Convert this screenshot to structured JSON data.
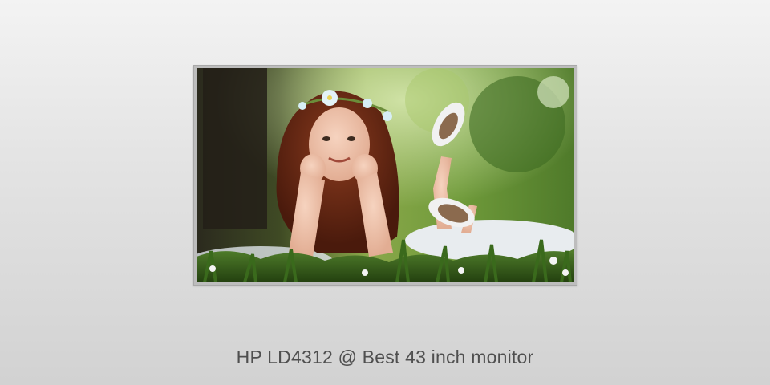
{
  "caption": "HP LD4312 @ Best 43 inch monitor",
  "image": {
    "subject": "girl-lying-in-grass-with-flower-crown"
  },
  "colors": {
    "background_top": "#f3f3f3",
    "background_bottom": "#d2d2d2",
    "bezel": "#bdbdbd",
    "caption_text": "#4f4f4f"
  }
}
